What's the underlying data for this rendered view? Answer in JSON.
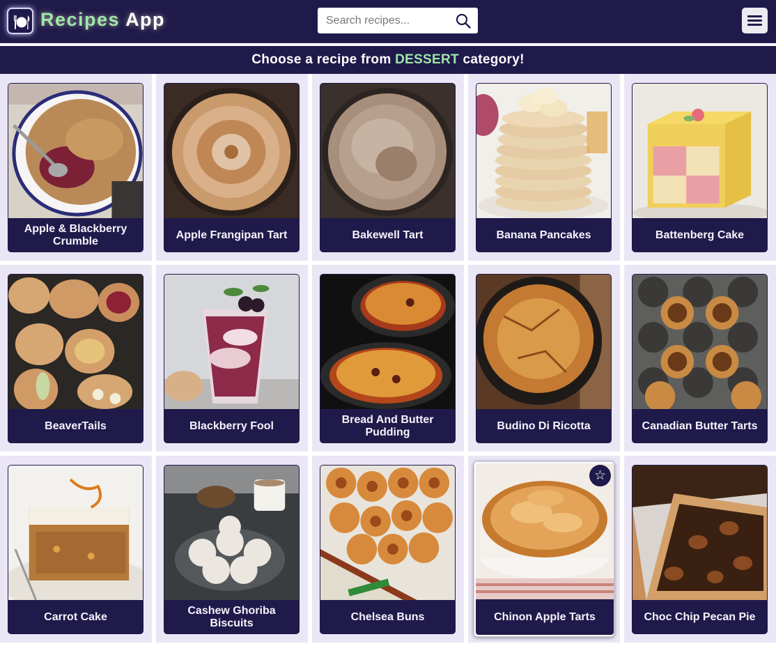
{
  "app": {
    "title_part1": "Recipes",
    "title_part2": "App"
  },
  "search": {
    "placeholder": "Search recipes..."
  },
  "banner": {
    "prefix": "Choose a recipe from ",
    "category": "DESSERT",
    "suffix": " category!"
  },
  "colors": {
    "brand_dark": "#1f1a4a",
    "accent_green": "#9fe6a8",
    "cell_background": "#ebe6f5"
  },
  "icons": {
    "logo": "plate-cutlery-icon",
    "search": "search-icon",
    "menu": "hamburger-menu-icon",
    "favorite": "star-icon"
  },
  "recipes": [
    {
      "name": "Apple & Blackberry Crumble"
    },
    {
      "name": "Apple Frangipan Tart"
    },
    {
      "name": "Bakewell Tart"
    },
    {
      "name": "Banana Pancakes"
    },
    {
      "name": "Battenberg Cake"
    },
    {
      "name": "BeaverTails"
    },
    {
      "name": "Blackberry Fool"
    },
    {
      "name": "Bread And Butter Pudding"
    },
    {
      "name": "Budino Di Ricotta"
    },
    {
      "name": "Canadian Butter Tarts"
    },
    {
      "name": "Carrot Cake"
    },
    {
      "name": "Cashew Ghoriba Biscuits"
    },
    {
      "name": "Chelsea Buns"
    },
    {
      "name": "Chinon Apple Tarts"
    },
    {
      "name": "Choc Chip Pecan Pie"
    }
  ]
}
